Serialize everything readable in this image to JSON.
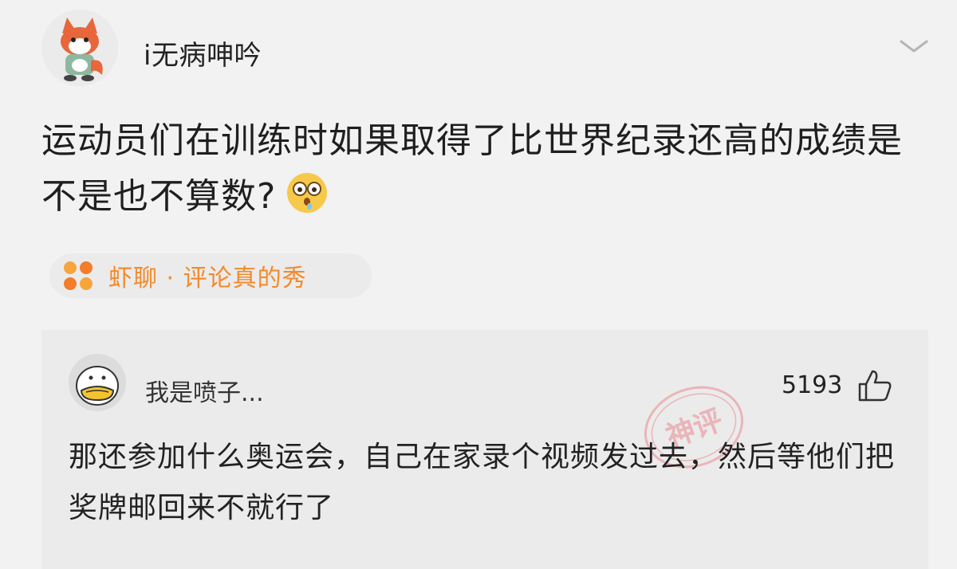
{
  "post": {
    "username": "i无病呻吟",
    "text": "运动员们在训练时如果取得了比世界纪录还高的成绩是不是也不算数?",
    "emoji": "flushed-face-emoji",
    "topic": "虾聊 · 评论真的秀"
  },
  "comment": {
    "username": "我是喷子...",
    "likes": "5193",
    "text": "那还参加什么奥运会，自己在家录个视频发过去，然后等他们把奖牌邮回来不就行了",
    "stamp": "神评"
  },
  "colors": {
    "background": "#f2f2f2",
    "topic_accent": "#f28a2b",
    "stamp_red": "#e88a92",
    "comment_bg": "#ebebeb"
  }
}
